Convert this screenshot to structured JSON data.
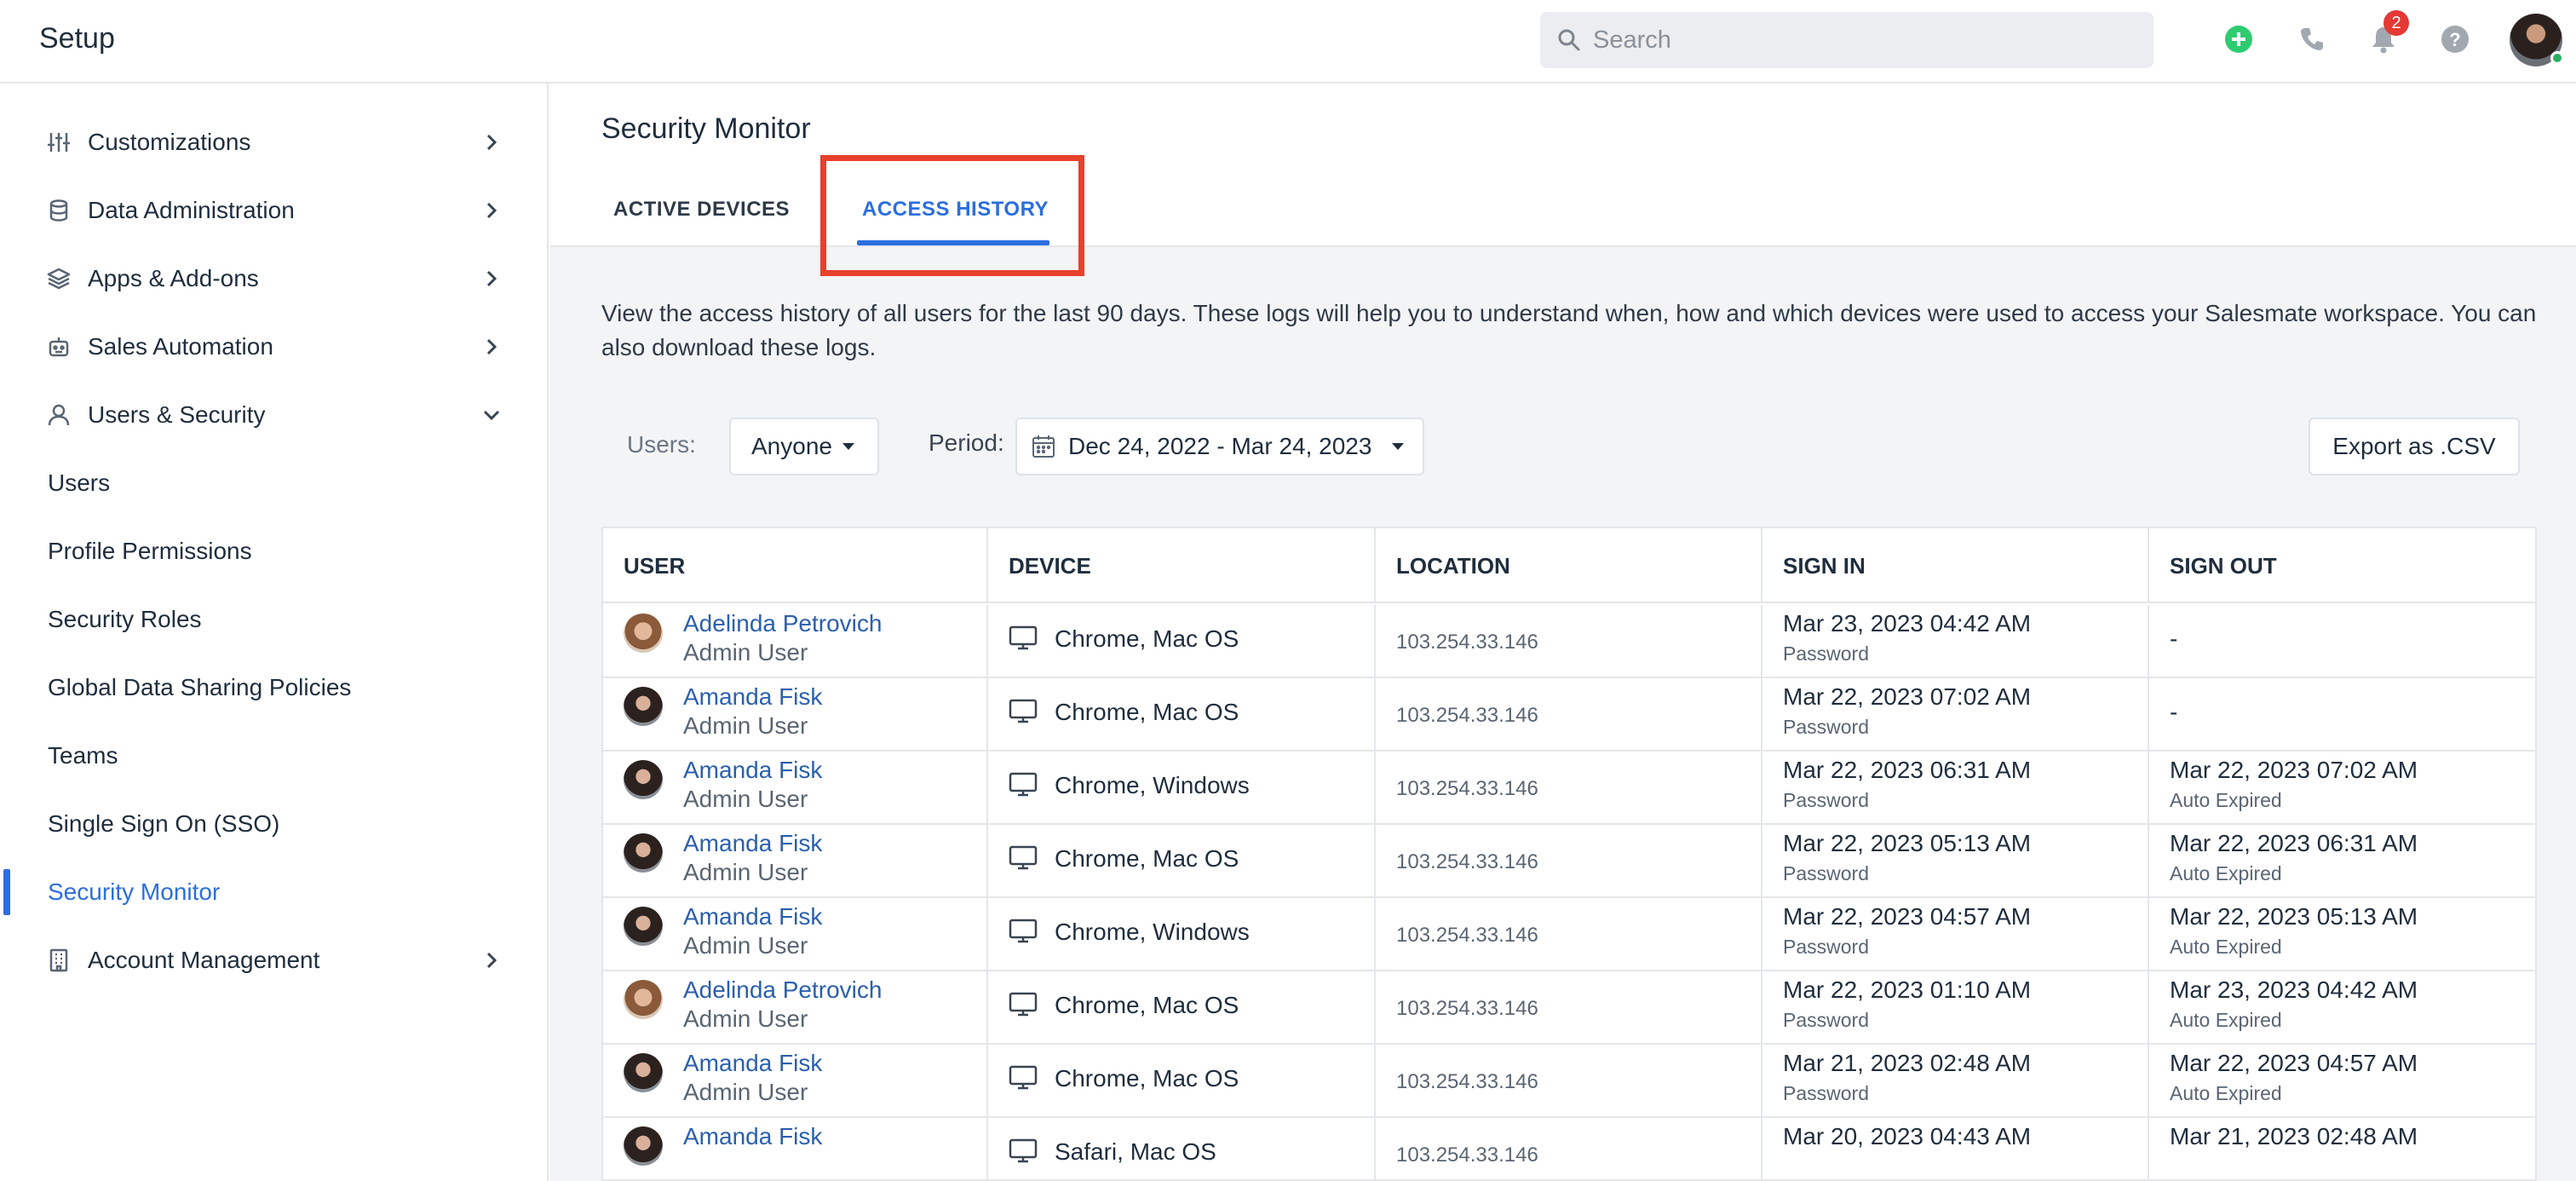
{
  "app": {
    "title": "Setup"
  },
  "header": {
    "search_placeholder": "Search",
    "notification_count": "2"
  },
  "sidebar": {
    "groups": [
      {
        "label": "Customizations",
        "icon": "sliders-icon"
      },
      {
        "label": "Data Administration",
        "icon": "database-icon"
      },
      {
        "label": "Apps & Add-ons",
        "icon": "layers-icon"
      },
      {
        "label": "Sales Automation",
        "icon": "robot-icon"
      },
      {
        "label": "Users & Security",
        "icon": "user-icon"
      }
    ],
    "sub_items": [
      {
        "label": "Users"
      },
      {
        "label": "Profile Permissions"
      },
      {
        "label": "Security Roles"
      },
      {
        "label": "Global Data Sharing Policies"
      },
      {
        "label": "Teams"
      },
      {
        "label": "Single Sign On (SSO)"
      },
      {
        "label": "Security Monitor"
      }
    ],
    "account": {
      "label": "Account Management",
      "icon": "building-icon"
    }
  },
  "main": {
    "title": "Security Monitor",
    "tabs": [
      {
        "label": "ACTIVE DEVICES"
      },
      {
        "label": "ACCESS HISTORY"
      }
    ],
    "active_tab": "ACCESS HISTORY",
    "description": "View the access history of all users for the last 90 days. These logs will help you to understand when, how and which devices were used to access your Salesmate workspace. You can also download these logs."
  },
  "filters": {
    "users_label": "Users:",
    "users_value": "Anyone",
    "period_label": "Period:",
    "period_value": "Dec 24, 2022 - Mar 24, 2023",
    "export_label": "Export as .CSV"
  },
  "table": {
    "columns": [
      "USER",
      "DEVICE",
      "LOCATION",
      "SIGN IN",
      "SIGN OUT"
    ],
    "rows": [
      {
        "user": "Adelinda Petrovich",
        "role": "Admin User",
        "avatar": "adelinda",
        "device": "Chrome, Mac OS",
        "location": "103.254.33.146",
        "sign_in": "Mar 23, 2023 04:42 AM",
        "sign_in_method": "Password",
        "sign_out": "-",
        "sign_out_reason": ""
      },
      {
        "user": "Amanda Fisk",
        "role": "Admin User",
        "avatar": "amanda",
        "device": "Chrome, Mac OS",
        "location": "103.254.33.146",
        "sign_in": "Mar 22, 2023 07:02 AM",
        "sign_in_method": "Password",
        "sign_out": "-",
        "sign_out_reason": ""
      },
      {
        "user": "Amanda Fisk",
        "role": "Admin User",
        "avatar": "amanda",
        "device": "Chrome, Windows",
        "location": "103.254.33.146",
        "sign_in": "Mar 22, 2023 06:31 AM",
        "sign_in_method": "Password",
        "sign_out": "Mar 22, 2023 07:02 AM",
        "sign_out_reason": "Auto Expired"
      },
      {
        "user": "Amanda Fisk",
        "role": "Admin User",
        "avatar": "amanda",
        "device": "Chrome, Mac OS",
        "location": "103.254.33.146",
        "sign_in": "Mar 22, 2023 05:13 AM",
        "sign_in_method": "Password",
        "sign_out": "Mar 22, 2023 06:31 AM",
        "sign_out_reason": "Auto Expired"
      },
      {
        "user": "Amanda Fisk",
        "role": "Admin User",
        "avatar": "amanda",
        "device": "Chrome, Windows",
        "location": "103.254.33.146",
        "sign_in": "Mar 22, 2023 04:57 AM",
        "sign_in_method": "Password",
        "sign_out": "Mar 22, 2023 05:13 AM",
        "sign_out_reason": "Auto Expired"
      },
      {
        "user": "Adelinda Petrovich",
        "role": "Admin User",
        "avatar": "adelinda",
        "device": "Chrome, Mac OS",
        "location": "103.254.33.146",
        "sign_in": "Mar 22, 2023 01:10 AM",
        "sign_in_method": "Password",
        "sign_out": "Mar 23, 2023 04:42 AM",
        "sign_out_reason": "Auto Expired"
      },
      {
        "user": "Amanda Fisk",
        "role": "Admin User",
        "avatar": "amanda",
        "device": "Chrome, Mac OS",
        "location": "103.254.33.146",
        "sign_in": "Mar 21, 2023 02:48 AM",
        "sign_in_method": "Password",
        "sign_out": "Mar 22, 2023 04:57 AM",
        "sign_out_reason": "Auto Expired"
      },
      {
        "user": "Amanda Fisk",
        "role": "",
        "avatar": "amanda",
        "device": "Safari, Mac OS",
        "location": "103.254.33.146",
        "sign_in": "Mar 20, 2023 04:43 AM",
        "sign_in_method": "",
        "sign_out": "Mar 21, 2023 02:48 AM",
        "sign_out_reason": ""
      }
    ]
  },
  "colors": {
    "accent": "#2b6ee0",
    "highlight": "#e8402b",
    "add": "#2ecc71",
    "badge": "#e53935"
  }
}
